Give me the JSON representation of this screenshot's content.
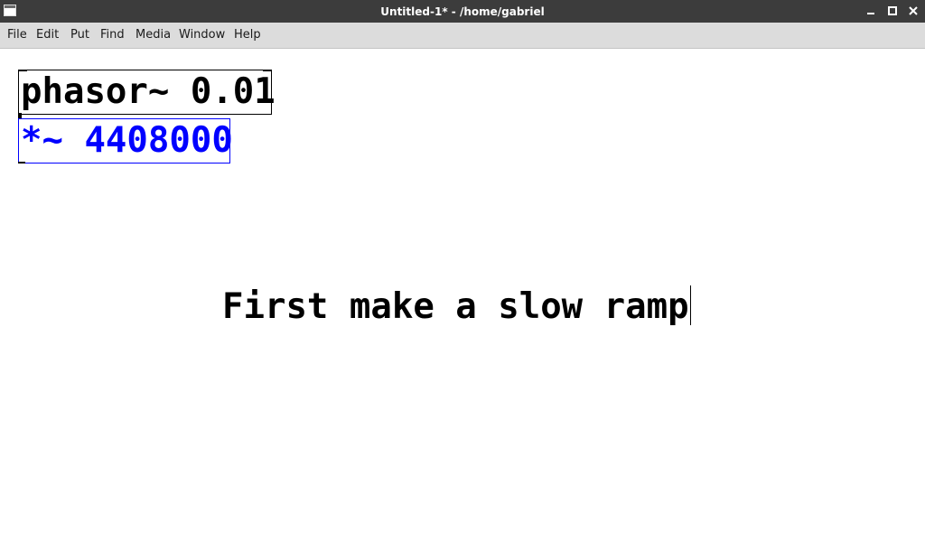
{
  "window": {
    "title": "Untitled-1* - /home/gabriel"
  },
  "menubar": {
    "items": [
      "File",
      "Edit",
      "Put",
      "Find",
      "Media",
      "Window",
      "Help"
    ]
  },
  "canvas": {
    "objects": [
      {
        "text": "phasor~ 0.01",
        "selected": false
      },
      {
        "text": "*~ 4408000",
        "selected": true
      }
    ],
    "comment": {
      "text": "First make a slow ramp",
      "editing": true
    }
  },
  "colors": {
    "titlebar": "#3c3c3c",
    "menubar": "#dcdcdc",
    "selected": "#0000ff",
    "object_border": "#000000"
  },
  "icons": {
    "app": "window-icon",
    "minimize": "minimize-icon",
    "maximize": "maximize-icon",
    "close": "close-icon"
  }
}
